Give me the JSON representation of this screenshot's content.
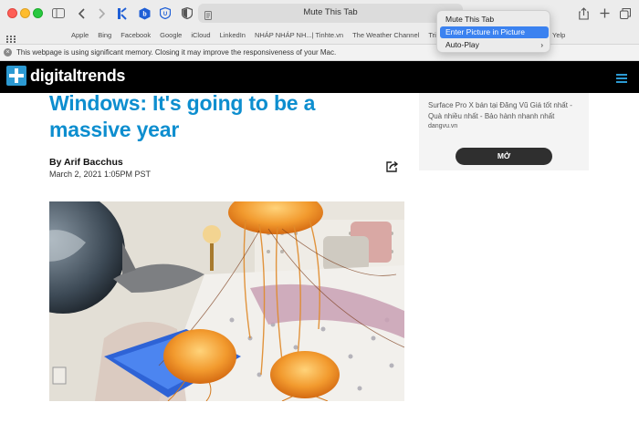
{
  "toolbar": {
    "tab_title": "Mute This Tab"
  },
  "favorites": {
    "items": [
      "Apple",
      "Bing",
      "Facebook",
      "Google",
      "iCloud",
      "LinkedIn",
      "NHÁP NHÁP NH...| Tinhte.vn",
      "The Weather Channel",
      "TripAdv"
    ],
    "last": "Yelp"
  },
  "memory_warning": {
    "text": "This webpage is using significant memory. Closing it may improve the responsiveness of your Mac."
  },
  "site": {
    "logo_text": "digitaltrends"
  },
  "article": {
    "headline": "Windows: It's going to be a massive year",
    "byline": "By Arif Bacchus",
    "date": "March 2, 2021 1:05PM PST"
  },
  "ad": {
    "title": "Surface Pro X bán tại Đăng Vũ Giá tốt nhất - Quà nhiều nhất - Bảo hành nhanh nhất",
    "domain": "dangvu.vn",
    "button": "MỞ"
  },
  "context_menu": {
    "items": [
      "Mute This Tab",
      "Enter Picture in Picture",
      "Auto-Play"
    ],
    "submenu_arrow": "›"
  },
  "colors": {
    "accent": "#0d8ecf",
    "menu_highlight": "#3b82f0",
    "header_bg": "#000000"
  }
}
